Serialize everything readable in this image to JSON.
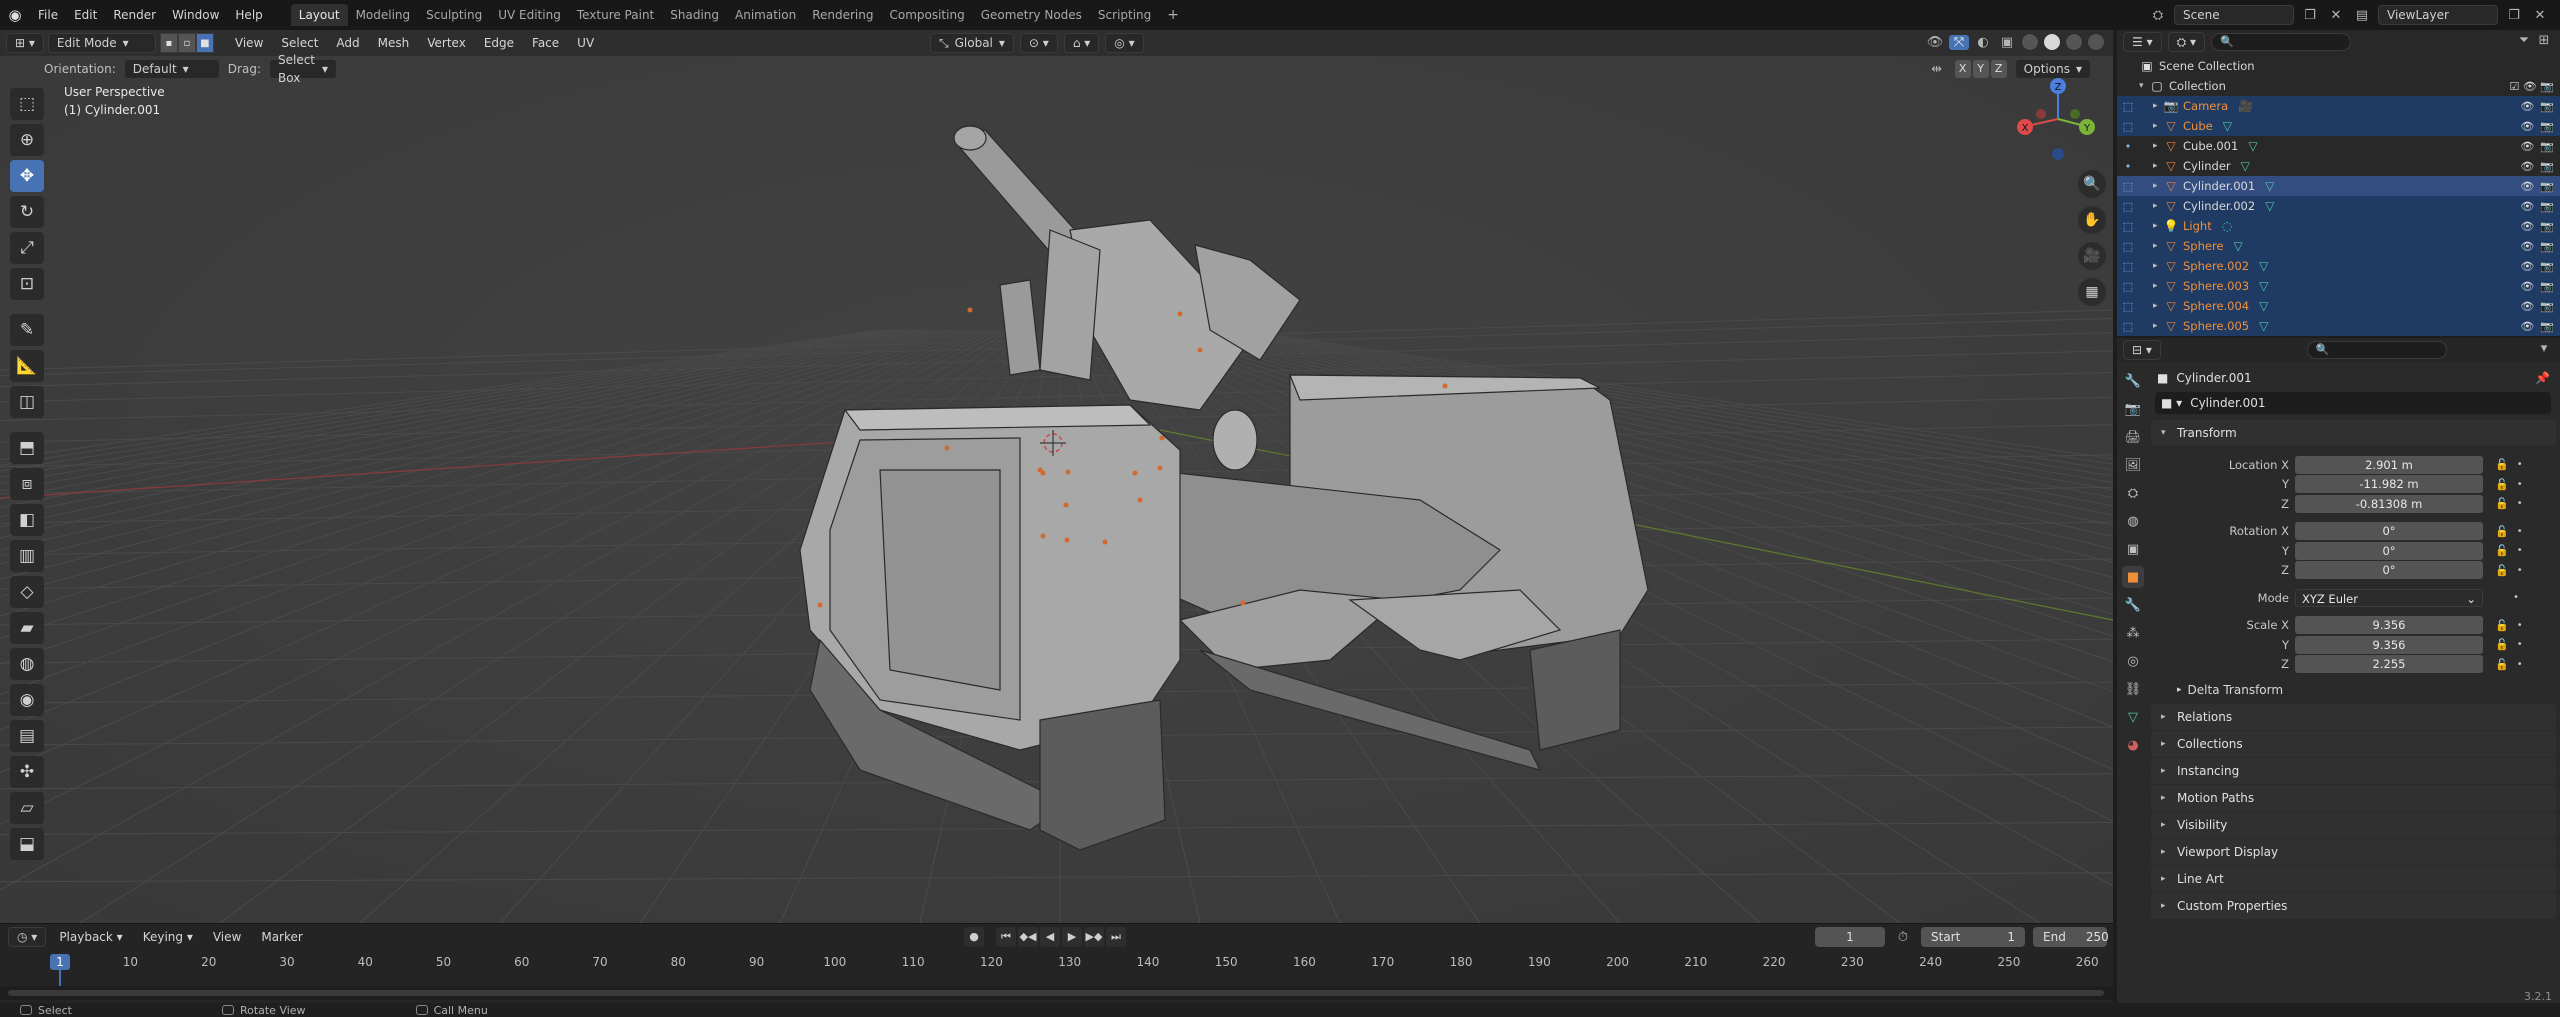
{
  "topbar": {
    "menus": [
      "File",
      "Edit",
      "Render",
      "Window",
      "Help"
    ],
    "workspaces": [
      "Layout",
      "Modeling",
      "Sculpting",
      "UV Editing",
      "Texture Paint",
      "Shading",
      "Animation",
      "Rendering",
      "Compositing",
      "Geometry Nodes",
      "Scripting"
    ],
    "add_tab": "+",
    "scene": "Scene",
    "view_layer": "ViewLayer"
  },
  "viewport": {
    "mode": "Edit Mode",
    "menus": [
      "View",
      "Select",
      "Add",
      "Mesh",
      "Vertex",
      "Edge",
      "Face",
      "UV"
    ],
    "orientation_label": "Orientation:",
    "orientation_value": "Default",
    "drag_label": "Drag:",
    "drag_value": "Select Box",
    "transform_space": "Global",
    "options": "Options",
    "xyz": [
      "X",
      "Y",
      "Z"
    ],
    "info_line1": "User Perspective",
    "info_line2": "(1) Cylinder.001",
    "gizmo_axes": [
      "X",
      "Y",
      "Z"
    ]
  },
  "timeline": {
    "menus": [
      "Playback",
      "Keying",
      "View",
      "Marker"
    ],
    "current_frame": "1",
    "start_label": "Start",
    "start_value": "1",
    "end_label": "End",
    "end_value": "250",
    "ruler": [
      "1",
      "10",
      "20",
      "30",
      "40",
      "50",
      "60",
      "70",
      "80",
      "90",
      "100",
      "110",
      "120",
      "130",
      "140",
      "150",
      "160",
      "170",
      "180",
      "190",
      "200",
      "210",
      "220",
      "230",
      "240",
      "250",
      "260"
    ]
  },
  "status": {
    "select": "Select",
    "rotate": "Rotate View",
    "menu": "Call Menu",
    "version": "3.2.1"
  },
  "outliner": {
    "scene_collection": "Scene Collection",
    "collection": "Collection",
    "items": [
      {
        "name": "Camera",
        "selected": true,
        "orange": true,
        "type": "camera"
      },
      {
        "name": "Cube",
        "selected": true,
        "orange": true,
        "type": "mesh"
      },
      {
        "name": "Cube.001",
        "selected": false,
        "orange": false,
        "type": "mesh"
      },
      {
        "name": "Cylinder",
        "selected": false,
        "orange": false,
        "type": "mesh"
      },
      {
        "name": "Cylinder.001",
        "selected": true,
        "orange": false,
        "active": true,
        "type": "mesh"
      },
      {
        "name": "Cylinder.002",
        "selected": true,
        "orange": false,
        "type": "mesh"
      },
      {
        "name": "Light",
        "selected": true,
        "orange": true,
        "type": "light"
      },
      {
        "name": "Sphere",
        "selected": true,
        "orange": true,
        "type": "mesh"
      },
      {
        "name": "Sphere.002",
        "selected": true,
        "orange": true,
        "type": "mesh"
      },
      {
        "name": "Sphere.003",
        "selected": true,
        "orange": true,
        "type": "mesh"
      },
      {
        "name": "Sphere.004",
        "selected": true,
        "orange": true,
        "type": "mesh"
      },
      {
        "name": "Sphere.005",
        "selected": true,
        "orange": true,
        "type": "mesh"
      }
    ]
  },
  "properties": {
    "object_title": "Cylinder.001",
    "object_name": "Cylinder.001",
    "transform": {
      "title": "Transform",
      "location_label": "Location X",
      "location": [
        "2.901 m",
        "-11.982 m",
        "-0.81308 m"
      ],
      "rotation_label": "Rotation X",
      "rotation": [
        "0°",
        "0°",
        "0°"
      ],
      "mode_label": "Mode",
      "mode_value": "XYZ Euler",
      "scale_label": "Scale X",
      "scale": [
        "9.356",
        "9.356",
        "2.255"
      ],
      "y_label": "Y",
      "z_label": "Z",
      "delta": "Delta Transform"
    },
    "panels": [
      "Relations",
      "Collections",
      "Instancing",
      "Motion Paths",
      "Visibility",
      "Viewport Display",
      "Line Art",
      "Custom Properties"
    ]
  },
  "colors": {
    "accent": "#4772b3",
    "selection_orange": "#f0903a",
    "mesh_green": "#4fc4a8",
    "viewport_bg": "#3d3d3d"
  }
}
